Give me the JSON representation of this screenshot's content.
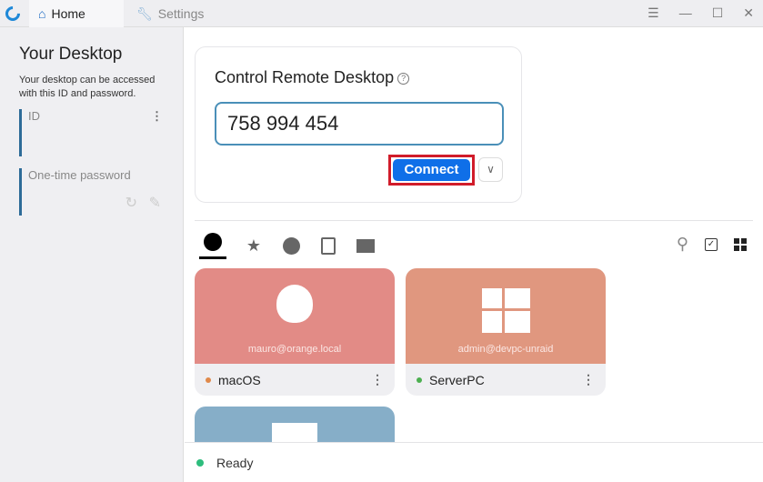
{
  "tabs": {
    "home": "Home",
    "settings": "Settings"
  },
  "sidebar": {
    "title": "Your Desktop",
    "description": "Your desktop can be accessed with this ID and password.",
    "id_label": "ID",
    "password_label": "One-time password"
  },
  "remote": {
    "title": "Control Remote Desktop",
    "id_value": "758 994 454",
    "connect_label": "Connect"
  },
  "peers": [
    {
      "name": "macOS",
      "address": "mauro@orange.local",
      "os": "apple",
      "status_color": "#e0894a",
      "tile_color": "#e28b86"
    },
    {
      "name": "ServerPC",
      "address": "admin@devpc-unraid",
      "os": "windows",
      "status_color": "#4caf50",
      "tile_color": "#e0977f"
    }
  ],
  "status": {
    "text": "Ready",
    "color": "#2ebd7d"
  }
}
